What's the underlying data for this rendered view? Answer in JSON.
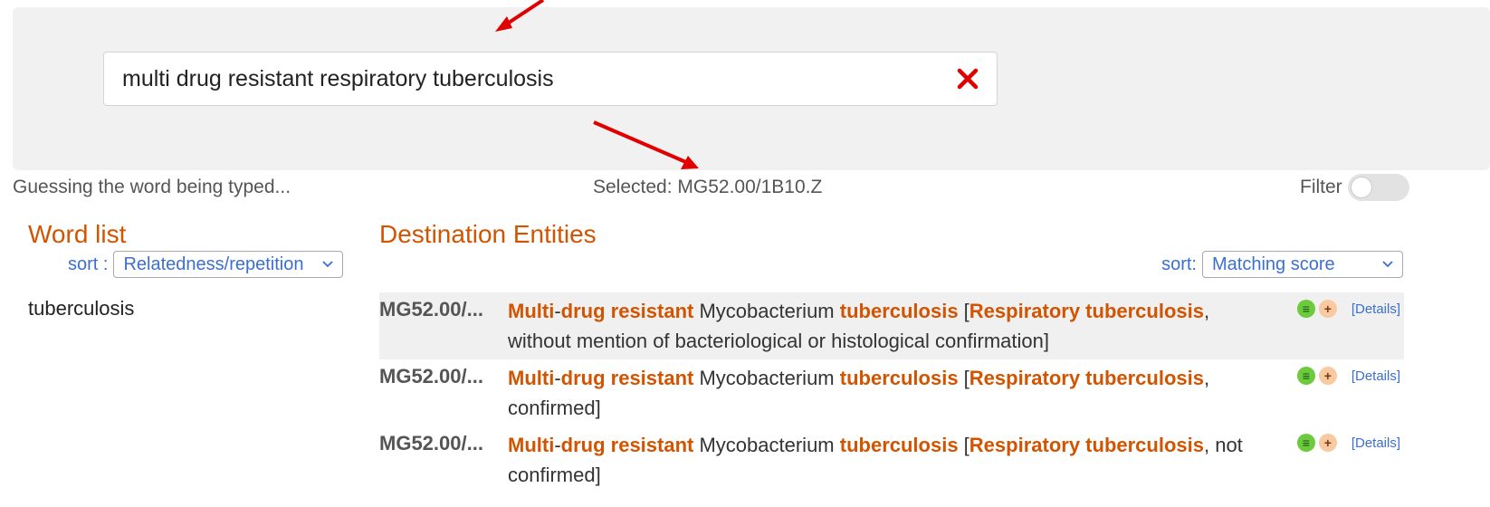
{
  "search": {
    "value": "multi drug resistant respiratory tuberculosis",
    "placeholder": ""
  },
  "status": {
    "guessing": "Guessing the word being typed...",
    "selected": "Selected: MG52.00/1B10.Z"
  },
  "filter": {
    "label": "Filter",
    "enabled": false
  },
  "word_list": {
    "title": "Word list",
    "sort_label": "sort :",
    "sort_value": "Relatedness/repetition",
    "items": [
      "tuberculosis"
    ]
  },
  "destination": {
    "title": "Destination Entities",
    "sort_label": "sort:",
    "sort_value": "Matching score",
    "details_label": "[Details]",
    "rows": [
      {
        "code": "MG52.00/...",
        "selected": true,
        "parts": [
          {
            "t": "Multi",
            "h": true
          },
          {
            "t": "-",
            "h": false
          },
          {
            "t": "drug resistant",
            "h": true
          },
          {
            "t": " Mycobacterium ",
            "h": false
          },
          {
            "t": "tuberculosis",
            "h": true
          },
          {
            "t": " [",
            "h": false
          },
          {
            "t": "Respiratory tuberculosis",
            "h": true
          },
          {
            "t": ", without mention of bacteriological or histological confirmation]",
            "h": false
          }
        ]
      },
      {
        "code": "MG52.00/...",
        "selected": false,
        "parts": [
          {
            "t": "Multi",
            "h": true
          },
          {
            "t": "-",
            "h": false
          },
          {
            "t": "drug resistant",
            "h": true
          },
          {
            "t": " Mycobacterium ",
            "h": false
          },
          {
            "t": "tuberculosis",
            "h": true
          },
          {
            "t": " [",
            "h": false
          },
          {
            "t": "Respiratory tuberculosis",
            "h": true
          },
          {
            "t": ", confirmed]",
            "h": false
          }
        ]
      },
      {
        "code": "MG52.00/...",
        "selected": false,
        "parts": [
          {
            "t": "Multi",
            "h": true
          },
          {
            "t": "-",
            "h": false
          },
          {
            "t": "drug resistant",
            "h": true
          },
          {
            "t": " Mycobacterium ",
            "h": false
          },
          {
            "t": "tuberculosis",
            "h": true
          },
          {
            "t": " [",
            "h": false
          },
          {
            "t": "Respiratory tuberculosis",
            "h": true
          },
          {
            "t": ", not confirmed]",
            "h": false
          }
        ]
      }
    ]
  },
  "icons": {
    "clear": "close-x-icon",
    "list": "list-icon",
    "add": "plus-icon",
    "arrow": "red-arrow-annotation"
  },
  "colors": {
    "accent": "#d35400",
    "link": "#3b6fd4",
    "clear": "#e00000",
    "arrow": "#e00000"
  }
}
